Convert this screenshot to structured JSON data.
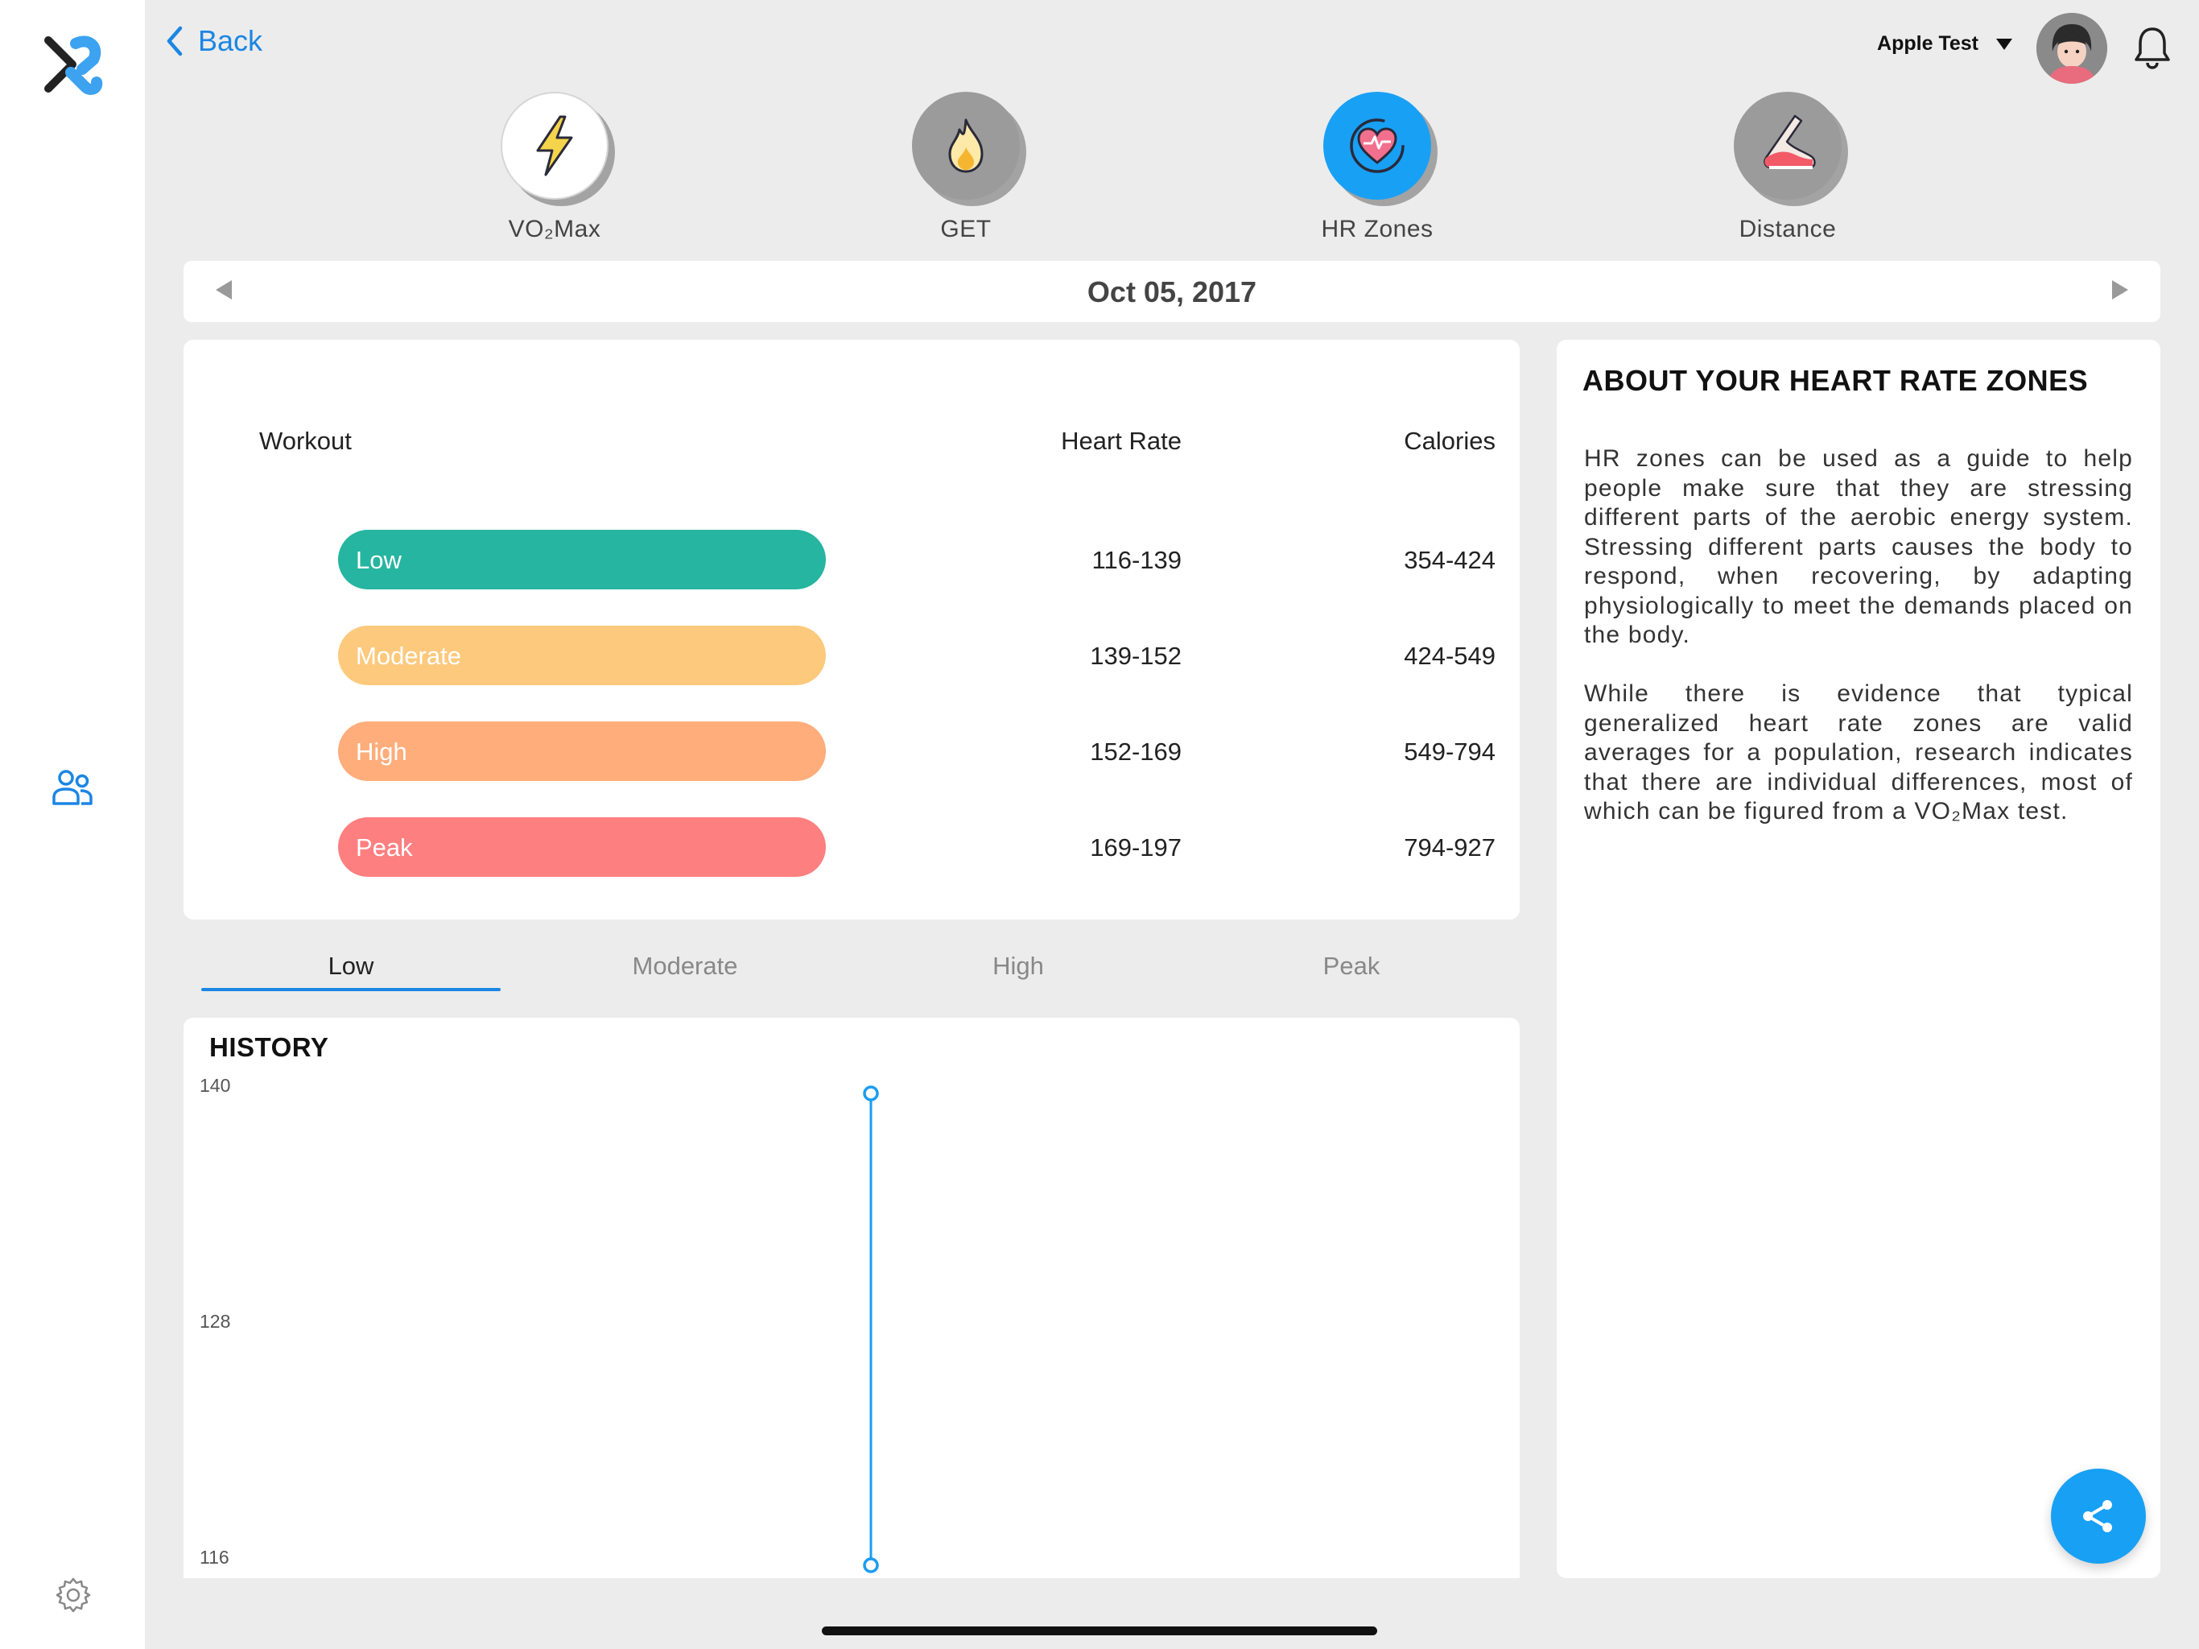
{
  "nav": {
    "back_label": "Back",
    "user_name": "Apple Test"
  },
  "metrics": [
    {
      "label": "VO₂Max",
      "icon": "lightning-icon",
      "active": false
    },
    {
      "label": "GET",
      "icon": "flame-icon",
      "active": false
    },
    {
      "label": "HR Zones",
      "icon": "heart-rate-icon",
      "active": true
    },
    {
      "label": "Distance",
      "icon": "running-shoe-icon",
      "active": false
    }
  ],
  "date": "Oct 05, 2017",
  "zones_table": {
    "headers": {
      "workout": "Workout",
      "heart_rate": "Heart Rate",
      "calories": "Calories"
    },
    "rows": [
      {
        "name": "Low",
        "heart_rate": "116-139",
        "calories": "354-424",
        "color": "#26b5a0"
      },
      {
        "name": "Moderate",
        "heart_rate": "139-152",
        "calories": "424-549",
        "color": "#fdc97d"
      },
      {
        "name": "High",
        "heart_rate": "152-169",
        "calories": "549-794",
        "color": "#fead7b"
      },
      {
        "name": "Peak",
        "heart_rate": "169-197",
        "calories": "794-927",
        "color": "#fd7f80"
      }
    ]
  },
  "zone_tabs": [
    "Low",
    "Moderate",
    "High",
    "Peak"
  ],
  "active_zone_tab": "Low",
  "history": {
    "title": "HISTORY"
  },
  "chart_data": {
    "type": "line",
    "title": "HISTORY",
    "ylim": [
      116,
      140
    ],
    "y_ticks": [
      140,
      128,
      116
    ],
    "series": [
      {
        "points": [
          {
            "y": 140
          },
          {
            "y": 116
          }
        ]
      }
    ],
    "grid": false,
    "color": "#1b9df0"
  },
  "about": {
    "heading": "ABOUT YOUR HEART RATE ZONES",
    "paragraph1": "HR zones can be used as a guide to help people make sure that they are stressing different parts of the aerobic energy system.  Stressing different parts causes the body to respond, when recovering, by adapting physiologically to meet the demands placed on the body.",
    "paragraph2": "While there is evidence that typical generalized heart rate zones are valid averages for a population, research indicates that there are individual differences, most of which can be figured from a VO₂Max test."
  },
  "colors": {
    "accent": "#1b86e3",
    "share": "#18a0f5"
  }
}
